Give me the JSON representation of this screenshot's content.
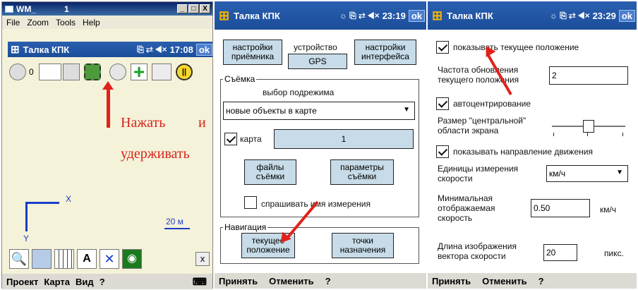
{
  "left": {
    "window_title": "WM_",
    "window_title_num": "1",
    "window_buttons": [
      "_",
      "□",
      "X"
    ],
    "menu": [
      "File",
      "Zoom",
      "Tools",
      "Help"
    ],
    "pda_title": "Талка КПК",
    "time": "17:08",
    "ok": "ok",
    "counter": "0",
    "hint_line1": "Нажать",
    "hint_line2": "и",
    "hint_line3": "удерживать",
    "axis_x": "X",
    "axis_y": "Y",
    "scale": "20 м",
    "bottom_menu": [
      "Проект",
      "Карта",
      "Вид",
      "?"
    ],
    "close_btn": "x"
  },
  "middle": {
    "title": "Талка КПК",
    "time": "23:19",
    "ok": "ok",
    "tabs": [
      {
        "label": "настройки\nприёмника"
      },
      {
        "label": "устройство"
      },
      {
        "label": "настройки\nинтерфейса"
      }
    ],
    "gps_btn": "GPS",
    "survey_group": "Съёмка",
    "submode_label": "выбор подрежима",
    "submode_value": "новые объекты в карте",
    "map_label": "карта",
    "map_value": "1",
    "files_btn": "файлы\nсъёмки",
    "params_btn": "параметры\nсъёмки",
    "ask_name": "спрашивать имя измерения",
    "nav_group": "Навигация",
    "current_pos_btn": "текущее\nположение",
    "targets_btn": "точки\nназначения",
    "bottom_accept": "Принять",
    "bottom_cancel": "Отменить",
    "bottom_help": "?"
  },
  "right": {
    "title": "Талка КПК",
    "time": "23:29",
    "ok": "ok",
    "show_position": "показывать текущее положение",
    "update_freq_label": "Частота обновления\nтекущего положения",
    "update_freq_value": "2",
    "autocenter": "автоцентрирование",
    "center_size_label": "Размер \"центральной\"\nобласти экрана",
    "center_size_level": 0.5,
    "show_direction": "показывать направление движения",
    "speed_units_label": "Единицы измерения\nскорости",
    "speed_units_value": "км/ч",
    "min_speed_label": "Минимальная\nотображаемая\nскорость",
    "min_speed_value": "0.50",
    "min_speed_unit": "км/ч",
    "vector_len_label": "Длина изображения\nвектора скорости",
    "vector_len_value": "20",
    "vector_len_unit": "пикс.",
    "bottom_accept": "Принять",
    "bottom_cancel": "Отменить",
    "bottom_help": "?"
  },
  "colors": {
    "titlebar": "#1b4e9a",
    "map_bg": "#f5f2da",
    "arrow": "#e0221a",
    "hint_text": "#d8231b",
    "axis": "#1a3cc8"
  }
}
